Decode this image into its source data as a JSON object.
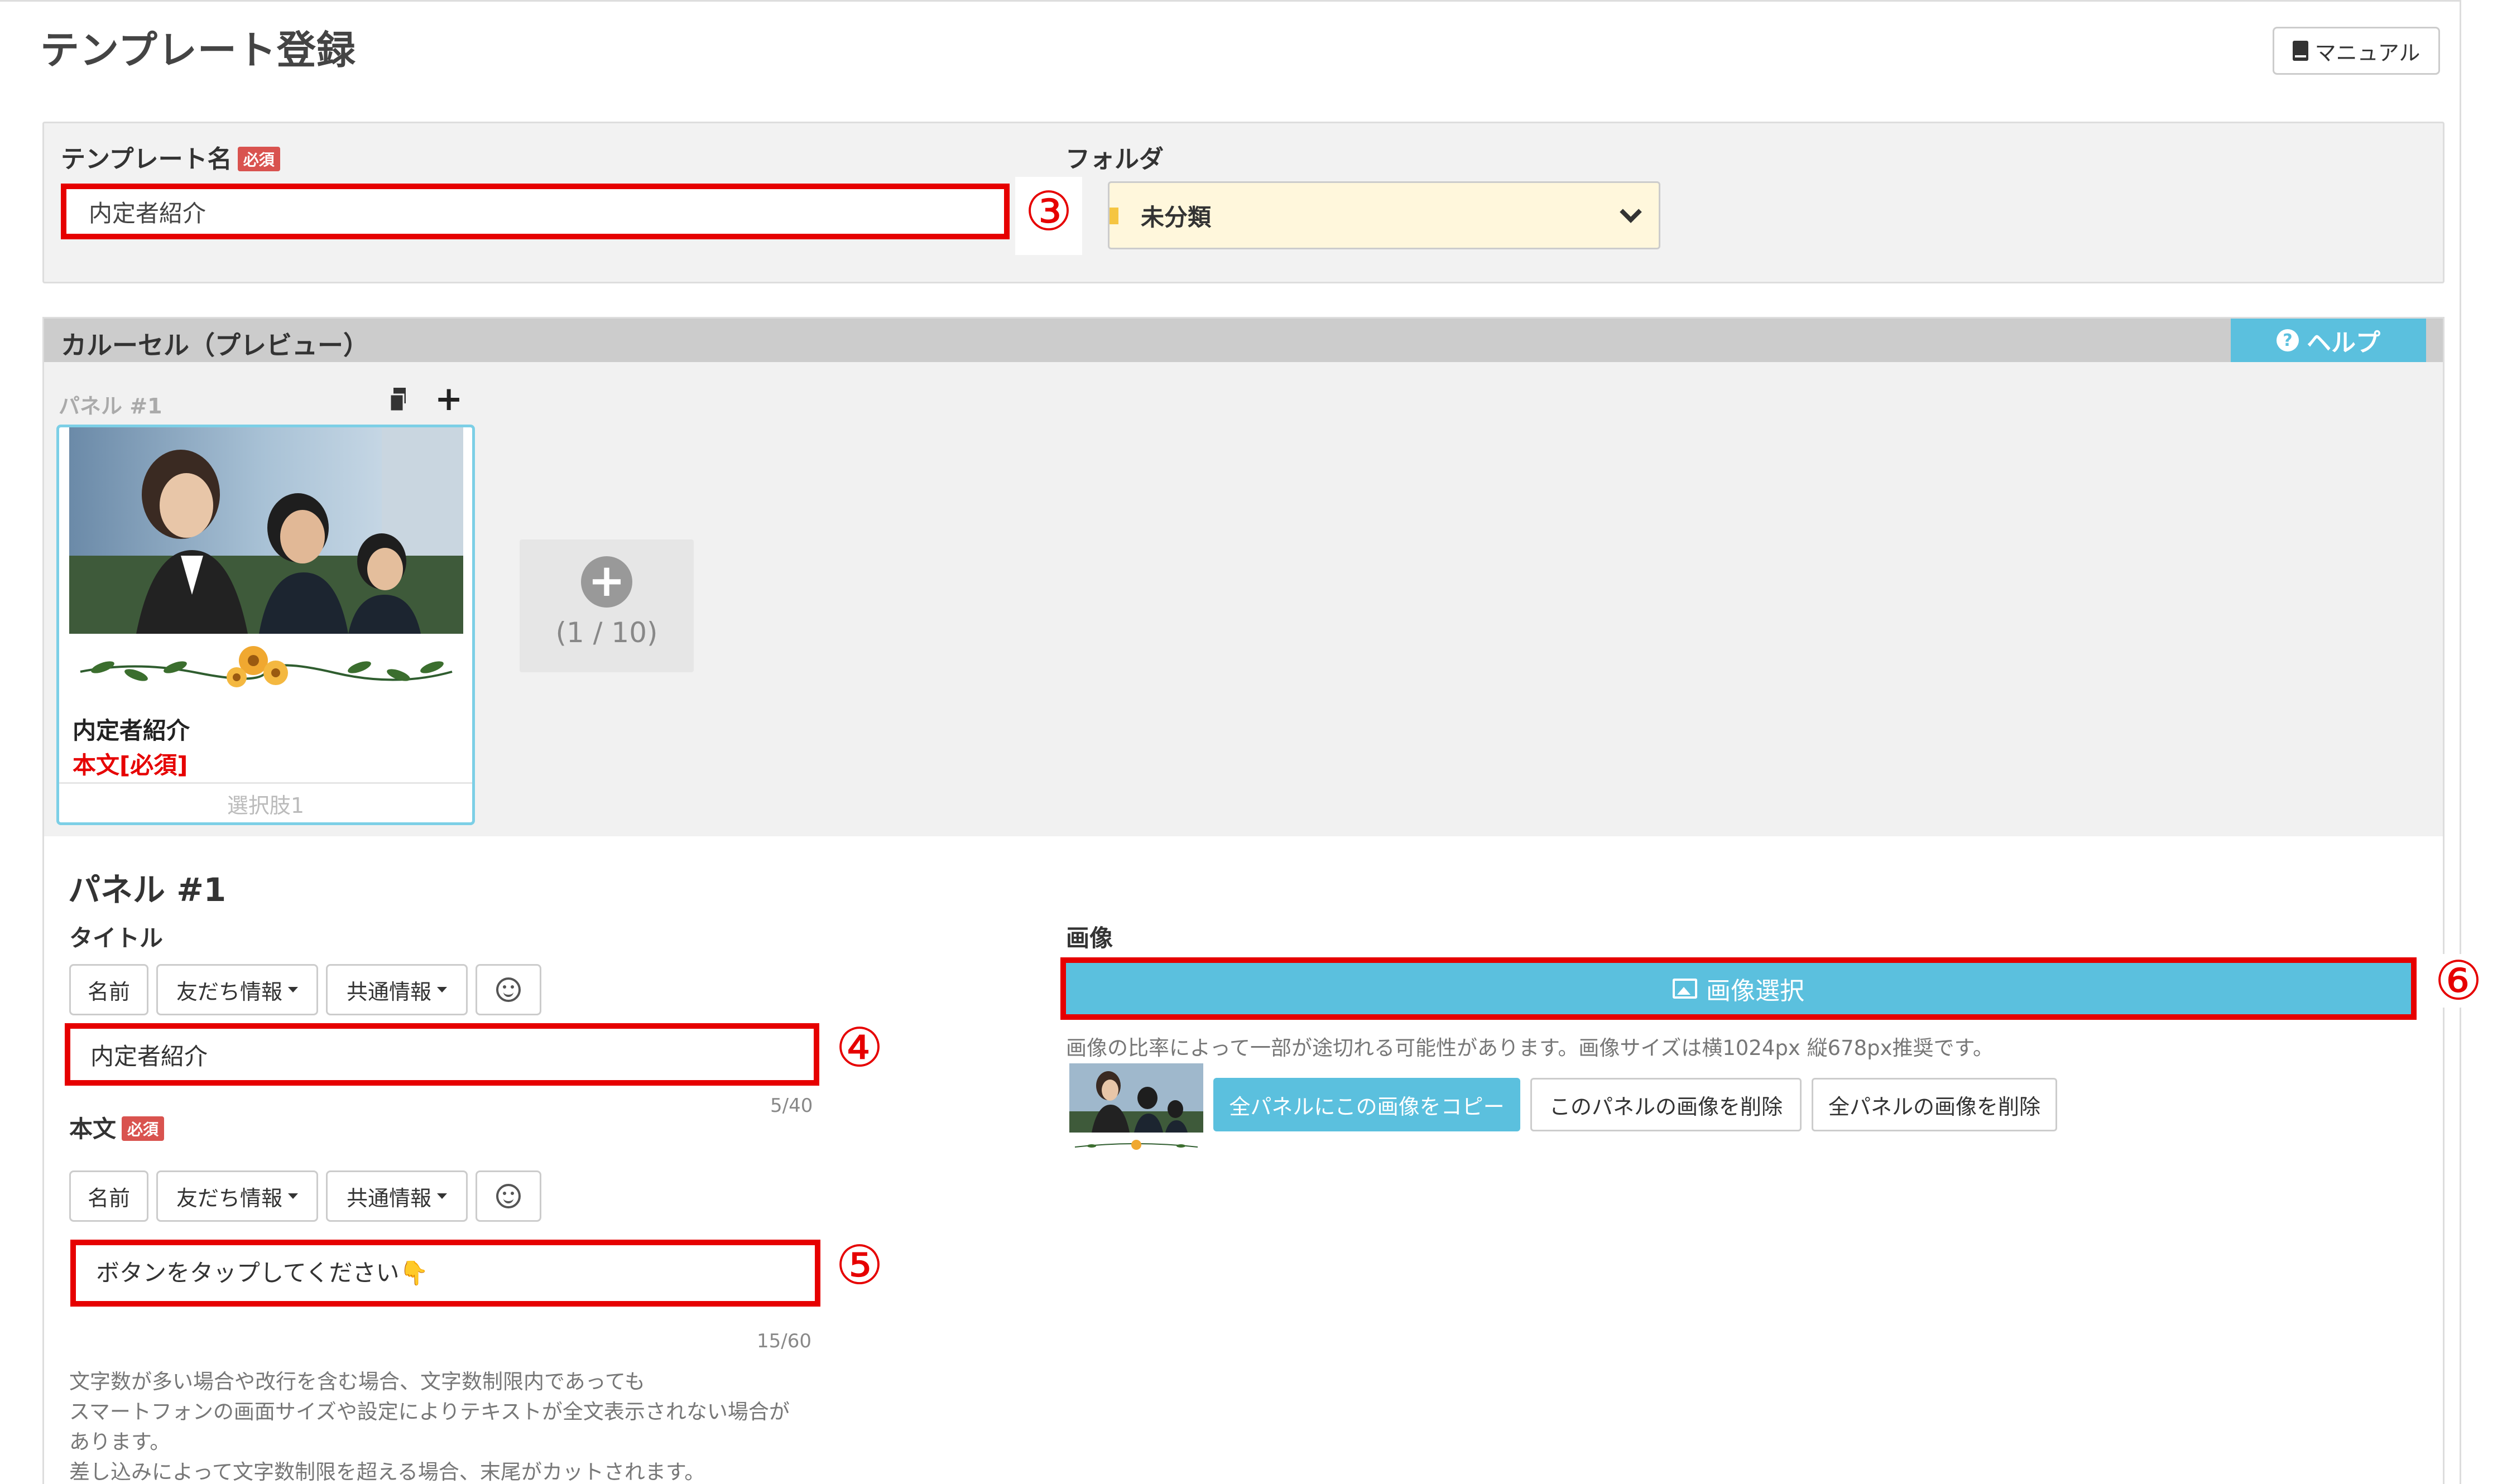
{
  "page": {
    "title": "テンプレート登録"
  },
  "header": {
    "manual_label": "マニュアル"
  },
  "template_name": {
    "label": "テンプレート名",
    "required_badge": "必須",
    "value": "内定者紹介",
    "marker": "③"
  },
  "folder": {
    "label": "フォルダ",
    "selected": "未分類"
  },
  "carousel": {
    "title": "カルーセル（プレビュー）",
    "help_label": "ヘルプ",
    "panel_label": "パネル #1",
    "card": {
      "title": "内定者紹介",
      "body": "本文[必須]",
      "option": "選択肢1"
    },
    "add_count": "(1 / 10)"
  },
  "panel": {
    "heading": "パネル #1",
    "title_field": {
      "label": "タイトル",
      "value": "内定者紹介",
      "counter": "5/40",
      "marker": "④"
    },
    "body_field": {
      "label": "本文",
      "required_badge": "必須",
      "value": "ボタンをタップしてください👇",
      "counter": "15/60",
      "marker": "⑤"
    },
    "toolbar": {
      "name": "名前",
      "friend_info": "友だち情報",
      "common_info": "共通情報"
    },
    "note_lines": [
      "文字数が多い場合や改行を含む場合、文字数制限内であっても",
      "スマートフォンの画面サイズや設定によりテキストが全文表示されない場合が",
      "あります。",
      "差し込みによって文字数制限を超える場合、末尾がカットされます。"
    ],
    "image": {
      "label": "画像",
      "select_button": "画像選択",
      "marker": "⑥",
      "note": "画像の比率によって一部が途切れる可能性があります。画像サイズは横1024px 縦678px推奨です。",
      "copy_all_button": "全パネルにこの画像をコピー",
      "delete_this_button": "このパネルの画像を削除",
      "delete_all_button": "全パネルの画像を削除"
    }
  },
  "colors": {
    "accent": "#5bc0de",
    "highlight": "#e60000",
    "required": "#d9534f",
    "folder_bg": "#fff7dc"
  }
}
